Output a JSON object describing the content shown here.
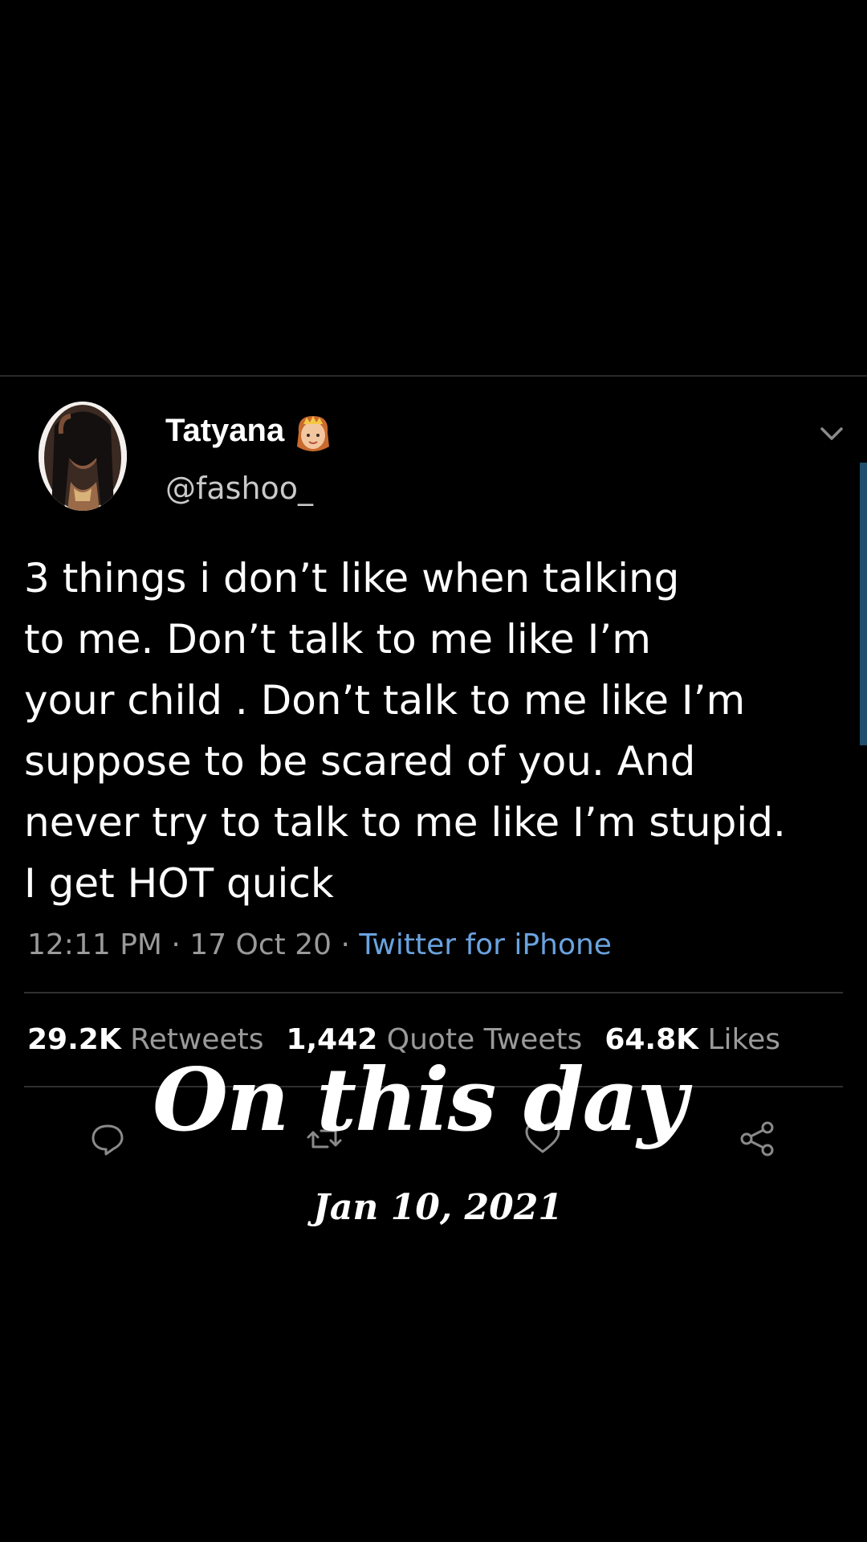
{
  "tweet": {
    "author": {
      "name": "Tatyana",
      "handle": "@fashoo_",
      "badge_icon": "princess-emoji-icon"
    },
    "text": "3 things i don’t like when talking\nto me. Don’t talk to me like I’m\nyour child . Don’t talk to me like I’m\nsuppose to be scared of you. And\nnever try to talk to me like I’m stupid.\nI get HOT quick",
    "timestamp": "12:11 PM · 17 Oct 20 · ",
    "source": "Twitter for iPhone",
    "stats": {
      "retweets_count": "29.2K",
      "retweets_label": "Retweets",
      "quotes_count": "1,442",
      "quotes_label": "Quote Tweets",
      "likes_count": "64.8K",
      "likes_label": "Likes"
    },
    "actions": [
      "reply-icon",
      "retweet-icon",
      "like-icon",
      "share-icon"
    ]
  },
  "overlay": {
    "title": "On this day",
    "date": "Jan 10, 2021"
  },
  "colors": {
    "background": "#000000",
    "text": "#ffffff",
    "muted": "#9a9a9a",
    "link": "#6aa3df"
  }
}
